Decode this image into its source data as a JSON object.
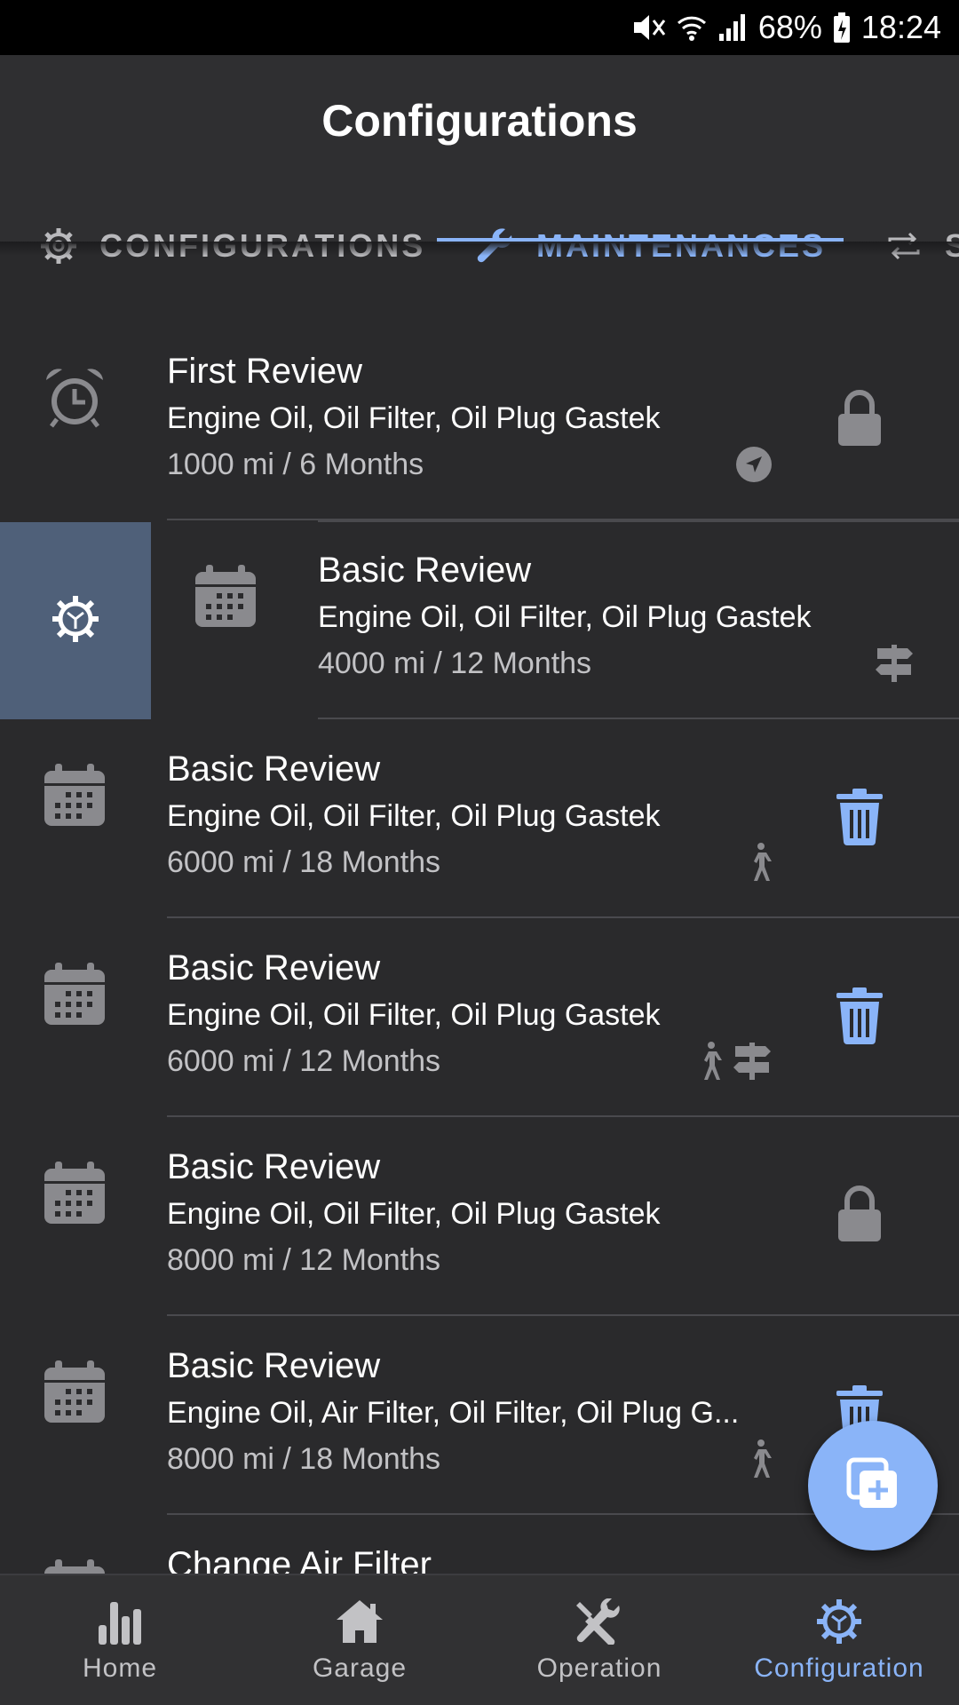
{
  "status_bar": {
    "battery": "68%",
    "time": "18:24"
  },
  "header": {
    "title": "Configurations"
  },
  "tabs": [
    {
      "label": "CONFIGURATIONS",
      "icon": "gear-icon",
      "active": false
    },
    {
      "label": "MAINTENANCES",
      "icon": "wrench-icon",
      "active": true
    },
    {
      "label": "S",
      "icon": "repeat-icon",
      "active": false
    }
  ],
  "maintenances": [
    {
      "title": "First Review",
      "parts": "Engine Oil, Oil Filter, Oil Plug Gastek",
      "interval": "1000 mi / 6 Months",
      "icon": "alarm-clock-icon",
      "action": "lock-icon",
      "badges": [
        "navigation-arrow-icon"
      ]
    },
    {
      "title": "Basic Review",
      "parts": "Engine Oil, Oil Filter, Oil Plug Gastek",
      "interval": "4000 mi / 12 Months",
      "icon": "calendar-icon",
      "action": "none",
      "badges": [
        "signpost-icon"
      ],
      "swiped": true,
      "swipe_action": "gear-icon"
    },
    {
      "title": "Basic Review",
      "parts": "Engine Oil, Oil Filter, Oil Plug Gastek",
      "interval": "6000 mi / 18 Months",
      "icon": "calendar-icon",
      "action": "trash-icon",
      "badges": [
        "walking-person-icon"
      ]
    },
    {
      "title": "Basic Review",
      "parts": "Engine Oil, Oil Filter, Oil Plug Gastek",
      "interval": "6000 mi / 12 Months",
      "icon": "calendar-icon",
      "action": "trash-icon",
      "badges": [
        "walking-person-icon",
        "signpost-icon"
      ]
    },
    {
      "title": "Basic Review",
      "parts": "Engine Oil, Oil Filter, Oil Plug Gastek",
      "interval": "8000 mi / 12 Months",
      "icon": "calendar-icon",
      "action": "lock-icon",
      "badges": []
    },
    {
      "title": "Basic Review",
      "parts": "Engine Oil, Air Filter, Oil Filter, Oil Plug G...",
      "interval": "8000 mi / 18 Months",
      "icon": "calendar-icon",
      "action": "trash-icon",
      "badges": [
        "walking-person-icon"
      ]
    },
    {
      "title": "Change Air Filter",
      "parts": "",
      "interval": "",
      "icon": "calendar-icon",
      "action": "none",
      "badges": []
    }
  ],
  "fab": {
    "icon": "add-copy-icon"
  },
  "bottom_nav": [
    {
      "label": "Home",
      "icon": "bar-chart-icon",
      "active": false
    },
    {
      "label": "Garage",
      "icon": "house-icon",
      "active": false
    },
    {
      "label": "Operation",
      "icon": "tools-icon",
      "active": false
    },
    {
      "label": "Configuration",
      "icon": "gear-icon",
      "active": true
    }
  ],
  "colors": {
    "accent": "#8ab4f8",
    "background": "#2a2a2c",
    "swipe": "#4f6079",
    "icon_gray": "#8a8a8e"
  }
}
